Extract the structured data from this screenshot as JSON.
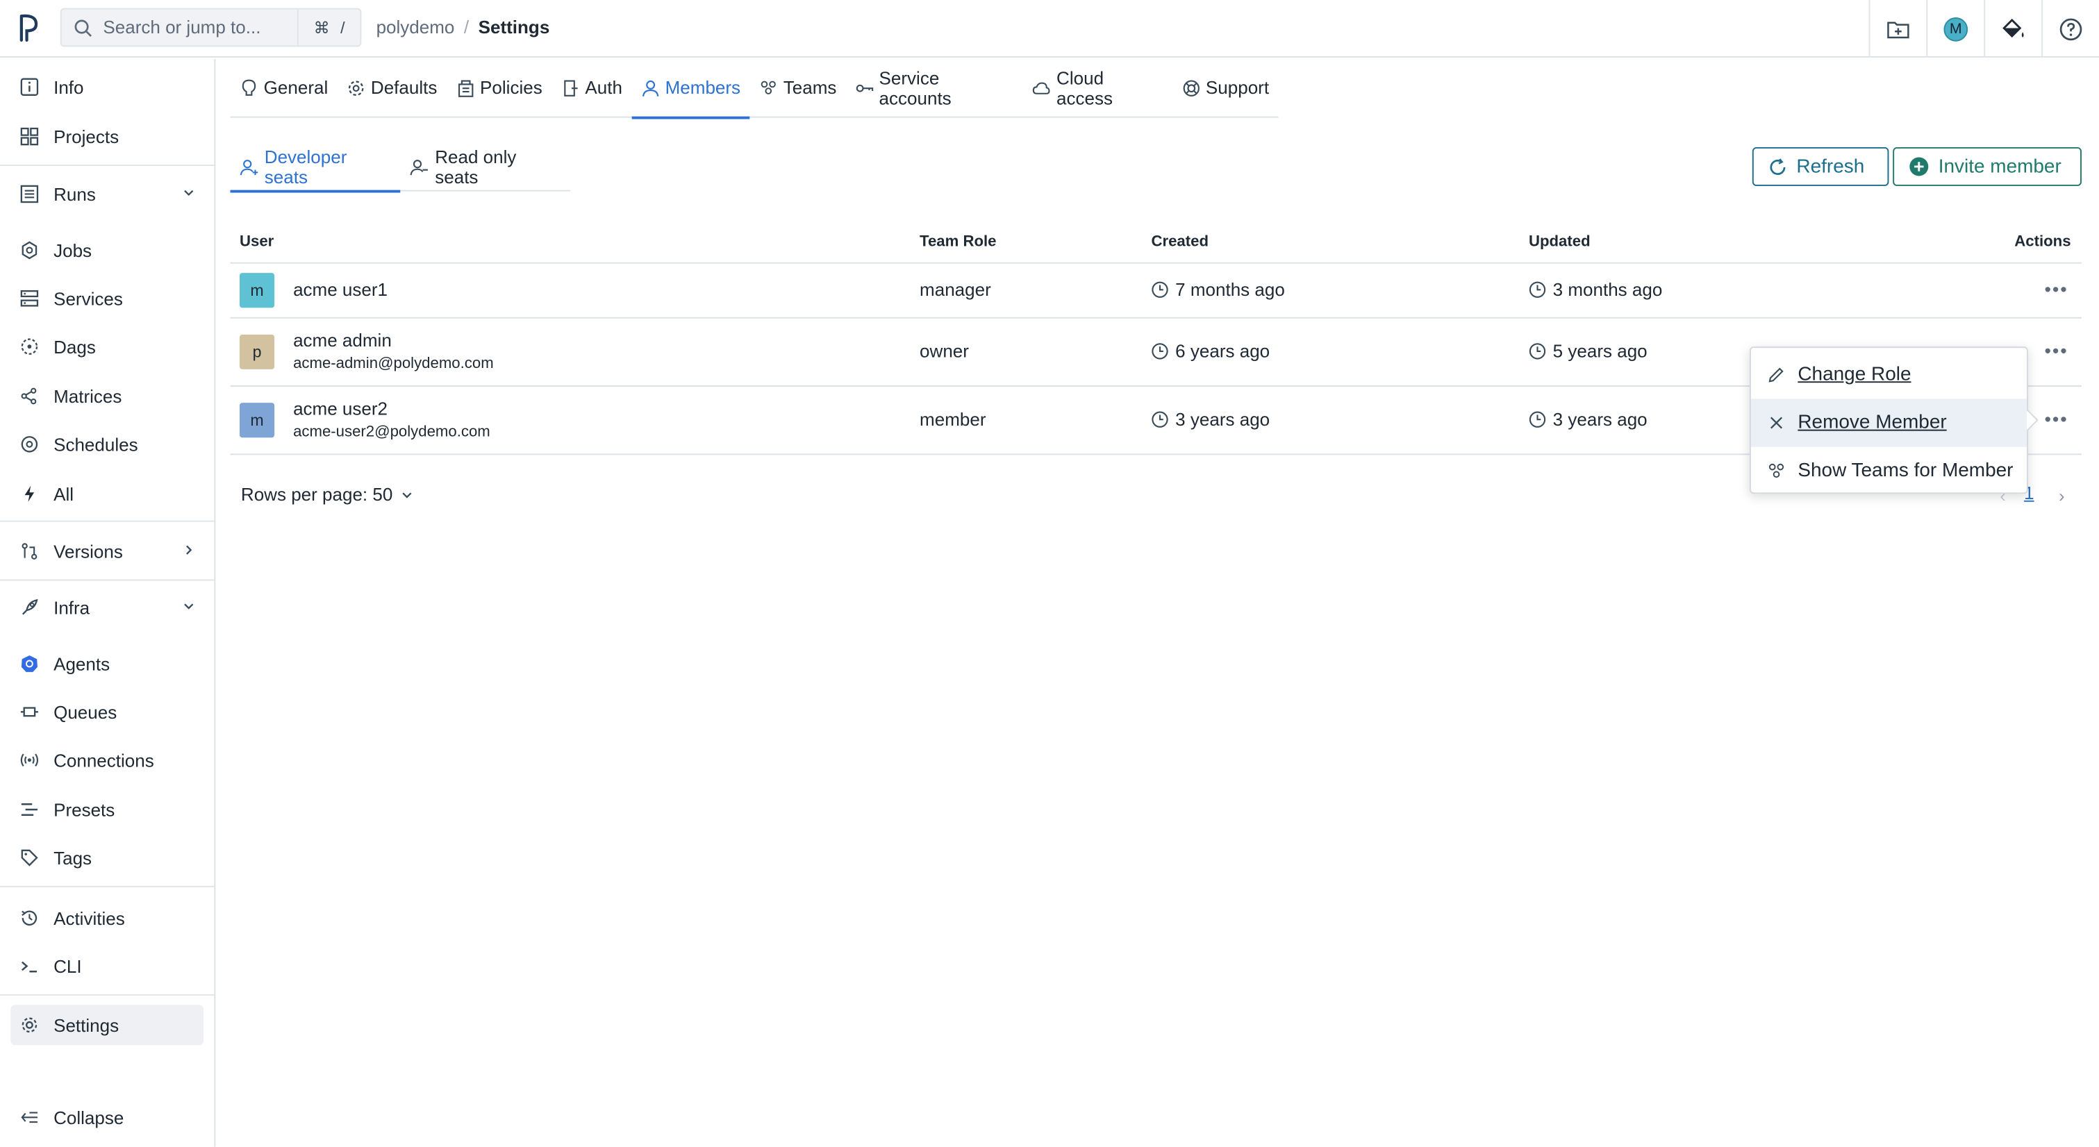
{
  "topbar": {
    "search_placeholder": "Search or jump to...",
    "kbd_cmd": "⌘",
    "kbd_slash": "/",
    "breadcrumb_org": "polydemo",
    "breadcrumb_sep": "/",
    "breadcrumb_page": "Settings",
    "user_initial": "M"
  },
  "sidebar": {
    "info": "Info",
    "projects": "Projects",
    "runs": "Runs",
    "jobs": "Jobs",
    "services": "Services",
    "dags": "Dags",
    "matrices": "Matrices",
    "schedules": "Schedules",
    "all": "All",
    "versions": "Versions",
    "infra": "Infra",
    "agents": "Agents",
    "queues": "Queues",
    "connections": "Connections",
    "presets": "Presets",
    "tags": "Tags",
    "activities": "Activities",
    "cli": "CLI",
    "settings": "Settings",
    "collapse": "Collapse"
  },
  "tabs": {
    "general": "General",
    "defaults": "Defaults",
    "policies": "Policies",
    "auth": "Auth",
    "members": "Members",
    "teams": "Teams",
    "service_accounts": "Service accounts",
    "cloud_access": "Cloud access",
    "support": "Support"
  },
  "subtabs": {
    "developer": "Developer seats",
    "readonly": "Read only seats"
  },
  "actions": {
    "refresh": "Refresh",
    "invite": "Invite member"
  },
  "table": {
    "headers": {
      "user": "User",
      "role": "Team Role",
      "created": "Created",
      "updated": "Updated",
      "actions": "Actions"
    },
    "rows": [
      {
        "initial": "m",
        "name": "acme user1",
        "email": "",
        "role": "manager",
        "created": "7 months ago",
        "updated": "3 months ago",
        "avatar_color": "#5ec2d4"
      },
      {
        "initial": "p",
        "name": "acme admin",
        "email": "acme-admin@polydemo.com",
        "role": "owner",
        "created": "6 years ago",
        "updated": "5 years ago",
        "avatar_color": "#d2c2a0"
      },
      {
        "initial": "m",
        "name": "acme user2",
        "email": "acme-user2@polydemo.com",
        "role": "member",
        "created": "3 years ago",
        "updated": "3 years ago",
        "avatar_color": "#7fa4d6"
      }
    ],
    "actions_glyph": "•••"
  },
  "pagination": {
    "rows_per_page": "Rows per page: 50",
    "page": "1"
  },
  "menu": {
    "change_role": "Change Role",
    "remove_member": "Remove Member",
    "show_teams": "Show Teams for Member"
  },
  "colors": {
    "accent": "#2d72d2",
    "teal": "#1c6e8c",
    "green": "#1f7a6b"
  }
}
